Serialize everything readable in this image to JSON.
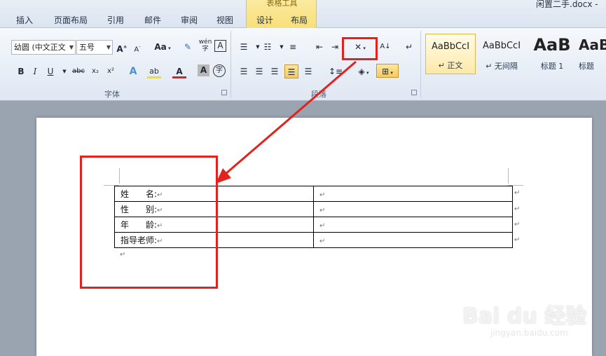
{
  "window": {
    "doc_title": "闲置二手.docx - "
  },
  "tabs": [
    {
      "label": "插入"
    },
    {
      "label": "页面布局"
    },
    {
      "label": "引用"
    },
    {
      "label": "邮件"
    },
    {
      "label": "审阅"
    },
    {
      "label": "视图"
    },
    {
      "label": "设计"
    },
    {
      "label": "布局"
    }
  ],
  "context_group": {
    "title": "表格工具"
  },
  "font_group": {
    "label": "字体",
    "font_name": "幼圆 (中文正文",
    "font_size": "五号",
    "grow_label": "A",
    "shrink_label": "A",
    "case_label": "Aa",
    "bold": "B",
    "italic": "I",
    "underline": "U",
    "strike": "abc",
    "subscript": "x₂",
    "superscript": "x²",
    "text_effect": "A",
    "highlight": "ab",
    "font_color": "A",
    "char_shade": "A",
    "enclose": "字",
    "phonetic": "wén",
    "border_char": "A"
  },
  "paragraph_group": {
    "label": "段落"
  },
  "styles": [
    {
      "sample": "AaBbCcI",
      "name": "↵ 正文"
    },
    {
      "sample": "AaBbCcI",
      "name": "↵ 无间隔"
    },
    {
      "sample": "AaB",
      "name": "标题 1"
    },
    {
      "sample": "AaB",
      "name": "标题"
    }
  ],
  "table": {
    "rows": [
      {
        "label": "姓　　名:",
        "value": ""
      },
      {
        "label": "性　　别:",
        "value": ""
      },
      {
        "label": "年　　龄:",
        "value": ""
      },
      {
        "label": "指导老师:",
        "value": ""
      }
    ],
    "cell_mark": "↵",
    "para_mark": "↵"
  },
  "watermark": {
    "text": "Bai du 经验",
    "sub": "jingyan.baidu.com"
  },
  "colors": {
    "annotation_red": "#e0231e",
    "highlight_yellow": "#f8c95c"
  }
}
